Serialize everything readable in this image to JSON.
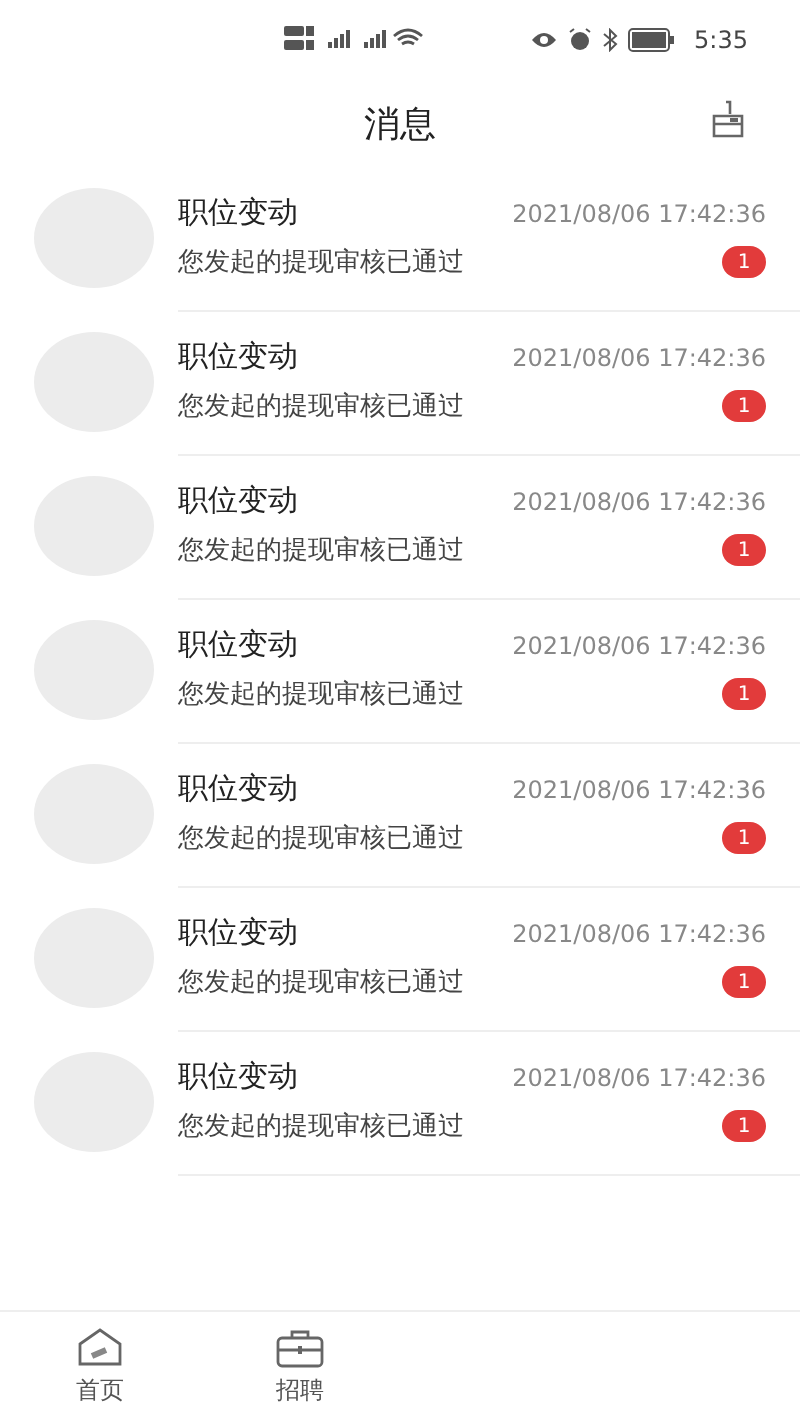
{
  "status_bar": {
    "time": "5:35"
  },
  "header": {
    "title": "消息"
  },
  "messages": [
    {
      "title": "职位变动",
      "time": "2021/08/06 17:42:36",
      "preview": "您发起的提现审核已通过",
      "unread": "1"
    },
    {
      "title": "职位变动",
      "time": "2021/08/06 17:42:36",
      "preview": "您发起的提现审核已通过",
      "unread": "1"
    },
    {
      "title": "职位变动",
      "time": "2021/08/06 17:42:36",
      "preview": "您发起的提现审核已通过",
      "unread": "1"
    },
    {
      "title": "职位变动",
      "time": "2021/08/06 17:42:36",
      "preview": "您发起的提现审核已通过",
      "unread": "1"
    },
    {
      "title": "职位变动",
      "time": "2021/08/06 17:42:36",
      "preview": "您发起的提现审核已通过",
      "unread": "1"
    },
    {
      "title": "职位变动",
      "time": "2021/08/06 17:42:36",
      "preview": "您发起的提现审核已通过",
      "unread": "1"
    },
    {
      "title": "职位变动",
      "time": "2021/08/06 17:42:36",
      "preview": "您发起的提现审核已通过",
      "unread": "1"
    }
  ],
  "tab_bar": [
    {
      "label": "首页",
      "kind": "home",
      "selected": false
    },
    {
      "label": "招聘",
      "kind": "jobs",
      "selected": false
    }
  ]
}
